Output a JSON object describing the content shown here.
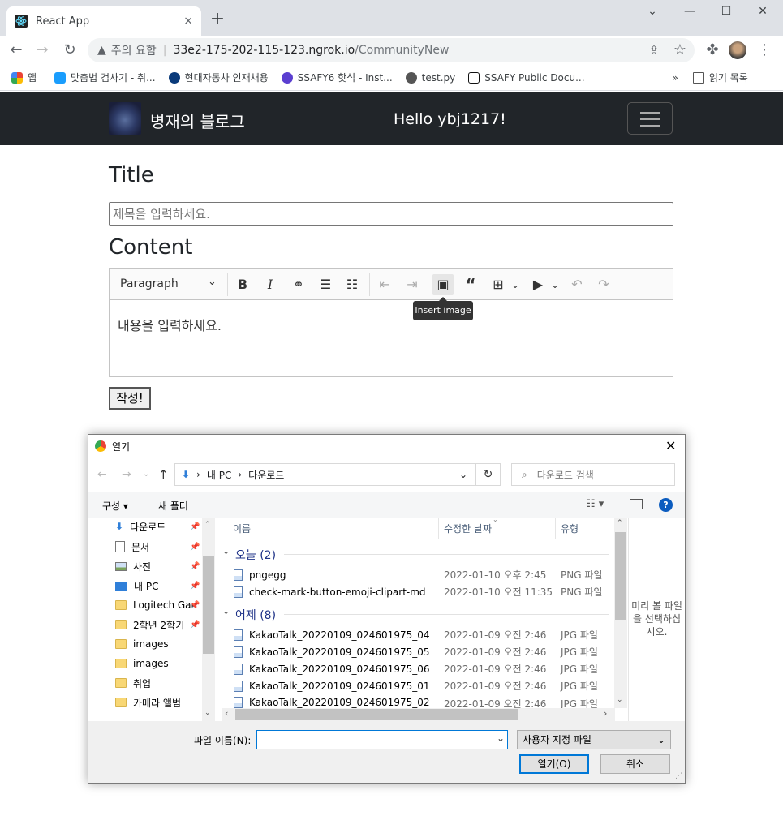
{
  "browser": {
    "tab_title": "React App",
    "tab_close": "×",
    "new_tab": "+",
    "address_warning": "주의 요함",
    "address_sep": "|",
    "url_host": "33e2-175-202-115-123.ngrok.io",
    "url_path": "/CommunityNew",
    "bookmarks": [
      {
        "label": "앱",
        "color": "#ea4335"
      },
      {
        "label": "맞춤법 검사기 - 취...",
        "color": "#1a9dfd"
      },
      {
        "label": "현대자동차 인재채용",
        "color": "#0a3a7a"
      },
      {
        "label": "SSAFY6 핫식 - Inst...",
        "color": "#5b3fd0"
      },
      {
        "label": "test.py",
        "color": "#555555"
      },
      {
        "label": "SSAFY Public Docu...",
        "color": "#111111"
      }
    ],
    "reading_list": "읽기 목록"
  },
  "navbar": {
    "brand": "병재의 블로그",
    "greeting": "Hello ybj1217!"
  },
  "form": {
    "title_heading": "Title",
    "title_placeholder": "제목을 입력하세요.",
    "content_heading": "Content",
    "editor": {
      "paragraph": "Paragraph",
      "tooltip": "Insert image",
      "placeholder": "내용을 입력하세요."
    },
    "submit_label": "작성!"
  },
  "dialog": {
    "title": "열기",
    "breadcrumb": [
      "내 PC",
      "다운로드"
    ],
    "search_placeholder": "다운로드 검색",
    "organize": "구성 ▾",
    "new_folder": "새 폴더",
    "sidebar": [
      {
        "label": "다운로드",
        "pinned": true
      },
      {
        "label": "문서",
        "pinned": true
      },
      {
        "label": "사진",
        "pinned": true
      },
      {
        "label": "내 PC",
        "pinned": true
      },
      {
        "label": "Logitech Gan",
        "pinned": true
      },
      {
        "label": "2학년 2학기",
        "pinned": true
      },
      {
        "label": "images",
        "pinned": false
      },
      {
        "label": "images",
        "pinned": false
      },
      {
        "label": "취업",
        "pinned": false
      },
      {
        "label": "카메라 앨범",
        "pinned": false
      }
    ],
    "columns": {
      "name": "이름",
      "date": "수정한 날짜",
      "type": "유형"
    },
    "groups": [
      {
        "label": "오늘 (2)",
        "files": [
          {
            "name": "pngegg",
            "date": "2022-01-10 오후 2:45",
            "type": "PNG 파일"
          },
          {
            "name": "check-mark-button-emoji-clipart-md",
            "date": "2022-01-10 오전 11:35",
            "type": "PNG 파일"
          }
        ]
      },
      {
        "label": "어제 (8)",
        "files": [
          {
            "name": "KakaoTalk_20220109_024601975_04",
            "date": "2022-01-09 오전 2:46",
            "type": "JPG 파일"
          },
          {
            "name": "KakaoTalk_20220109_024601975_05",
            "date": "2022-01-09 오전 2:46",
            "type": "JPG 파일"
          },
          {
            "name": "KakaoTalk_20220109_024601975_06",
            "date": "2022-01-09 오전 2:46",
            "type": "JPG 파일"
          },
          {
            "name": "KakaoTalk_20220109_024601975_01",
            "date": "2022-01-09 오전 2:46",
            "type": "JPG 파일"
          },
          {
            "name": "KakaoTalk_20220109_024601975_02",
            "date": "2022-01-09 오전 2:46",
            "type": "JPG 파일"
          }
        ]
      }
    ],
    "preview_text": "미리 볼 파일을 선택하십시오.",
    "filename_label": "파일 이름(N):",
    "filename_value": "",
    "filetype": "사용자 지정 파일",
    "open_button": "열기(O)",
    "cancel_button": "취소"
  }
}
